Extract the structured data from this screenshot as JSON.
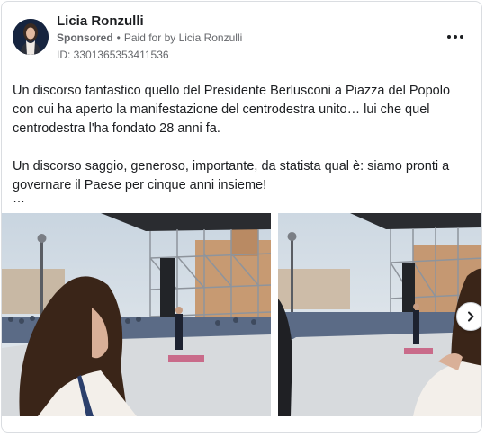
{
  "post": {
    "author_name": "Licia Ronzulli",
    "sponsored_label": "Sponsored",
    "separator": "•",
    "paid_for_text": "Paid for by Licia Ronzulli",
    "ad_id": "ID: 3301365353411536",
    "body_paragraph_1": "Un discorso fantastico quello del Presidente Berlusconi a Piazza del Popolo con cui ha aperto la manifestazione del centrodestra unito… lui che quel centrodestra l'ha fondato 28 anni fa.",
    "body_paragraph_2": "Un discorso saggio, generoso, importante, da statista qual è: siamo pronti a governare il Paese per cinque anni insieme!",
    "truncation": "…"
  },
  "icons": {
    "more": "more-options-icon",
    "next": "chevron-right-icon"
  },
  "colors": {
    "text": "#1c1e21",
    "secondary_text": "#65676b",
    "card_border": "#dadde1",
    "avatar_bg": "#16243f"
  }
}
